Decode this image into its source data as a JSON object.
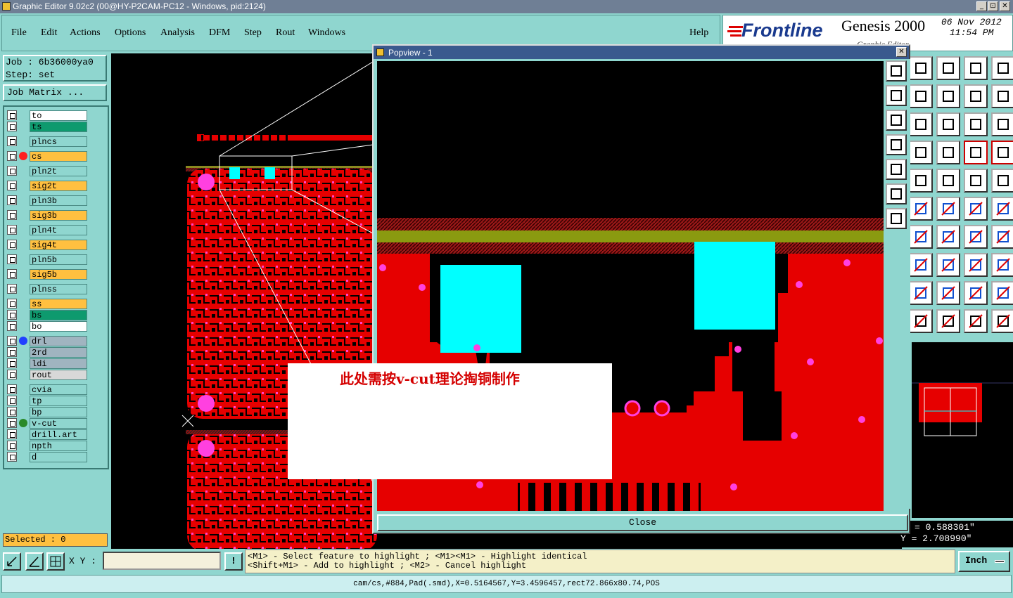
{
  "window": {
    "title": "Graphic Editor 9.02c2 (00@HY-P2CAM-PC12 - Windows, pid:2124)",
    "min_label": "_",
    "max_label": "⊡",
    "close_label": "✕"
  },
  "menu": {
    "items": [
      "File",
      "Edit",
      "Actions",
      "Options",
      "Analysis",
      "DFM",
      "Step",
      "Rout",
      "Windows"
    ],
    "help": "Help"
  },
  "brand": {
    "logo": "Frontline",
    "product": "Genesis 2000",
    "subtitle": "Graphic Editor",
    "date": "06 Nov 2012",
    "time": "11:54 PM"
  },
  "job": {
    "job_line": "Job : 6b36000ya0",
    "step_line": "Step: set",
    "matrix_button": "Job Matrix ..."
  },
  "layers": [
    {
      "name": "to",
      "color": "#ffffff",
      "dot": ""
    },
    {
      "name": "ts",
      "color": "#0e9a6e",
      "dot": ""
    },
    {
      "name": "plncs",
      "color": "#8fd6cf",
      "dot": ""
    },
    {
      "name": "cs",
      "color": "#ffc040",
      "dot": "#ff2020"
    },
    {
      "name": "pln2t",
      "color": "#8fd6cf",
      "dot": ""
    },
    {
      "name": "sig2t",
      "color": "#ffc040",
      "dot": ""
    },
    {
      "name": "pln3b",
      "color": "#8fd6cf",
      "dot": ""
    },
    {
      "name": "sig3b",
      "color": "#ffc040",
      "dot": ""
    },
    {
      "name": "pln4t",
      "color": "#8fd6cf",
      "dot": ""
    },
    {
      "name": "sig4t",
      "color": "#ffc040",
      "dot": ""
    },
    {
      "name": "pln5b",
      "color": "#8fd6cf",
      "dot": ""
    },
    {
      "name": "sig5b",
      "color": "#ffc040",
      "dot": ""
    },
    {
      "name": "plnss",
      "color": "#8fd6cf",
      "dot": ""
    },
    {
      "name": "ss",
      "color": "#ffc040",
      "dot": ""
    },
    {
      "name": "bs",
      "color": "#0e9a6e",
      "dot": ""
    },
    {
      "name": "bo",
      "color": "#ffffff",
      "dot": ""
    },
    {
      "name": "drl",
      "color": "#a0b4c0",
      "dot": "#2040ff"
    },
    {
      "name": "2rd",
      "color": "#a0b4c0",
      "dot": ""
    },
    {
      "name": "ldi",
      "color": "#a0b4c0",
      "dot": ""
    },
    {
      "name": "rout",
      "color": "#d8d8d8",
      "dot": ""
    },
    {
      "name": "cvia",
      "color": "#8fd6cf",
      "dot": ""
    },
    {
      "name": "tp",
      "color": "#8fd6cf",
      "dot": ""
    },
    {
      "name": "bp",
      "color": "#8fd6cf",
      "dot": ""
    },
    {
      "name": "v-cut",
      "color": "#8fd6cf",
      "dot": "#2a8a2a"
    },
    {
      "name": "drill.art",
      "color": "#8fd6cf",
      "dot": ""
    },
    {
      "name": "npth",
      "color": "#8fd6cf",
      "dot": ""
    },
    {
      "name": "d",
      "color": "#8fd6cf",
      "dot": ""
    }
  ],
  "selected": "Selected : 0",
  "popview": {
    "title": "Popview - 1",
    "close_label": "Close"
  },
  "annotation": "此处需按v-cut理论掏铜制作",
  "coords": {
    "x": "= 0.588301\"",
    "y": "Y = 2.708990\""
  },
  "bottom": {
    "xy_label": "X Y :",
    "xy_value": "",
    "xy_marker": "!",
    "hint_line1": "<M1> - Select feature to highlight ; <M1><M1> - Highlight identical",
    "hint_line2": "<Shift+M1> - Add to highlight ; <M2> - Cancel highlight",
    "units": "Inch",
    "status": "cam/cs,#884,Pad(.smd),X=0.5164567,Y=3.4596457,rect72.866x80.74,POS"
  }
}
